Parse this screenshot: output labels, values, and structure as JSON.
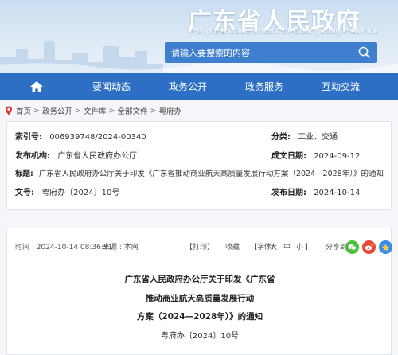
{
  "banner": {
    "title": "广东省人民政府",
    "subtitle": "People's Government of Guangdong Province",
    "search_placeholder": "请输入要搜索的内容"
  },
  "nav": {
    "items": [
      "要闻动态",
      "政务公开",
      "政务服务",
      "互动交流"
    ],
    "bg_color": "#2e6fc6"
  },
  "breadcrumb": {
    "items": [
      "首页",
      "政务公开",
      "文件库",
      "全部文件",
      "粤府办"
    ],
    "separator": ">"
  },
  "meta": {
    "index_label": "索引号:",
    "index_value": "006939748/2024-00340",
    "category_label": "分类:",
    "category_value": "工业、交通",
    "issuer_label": "发布机构:",
    "issuer_value": "广东省人民政府办公厅",
    "created_label": "成文日期:",
    "created_value": "2024-09-12",
    "title_label": "标题:",
    "title_value": "广东省人民政府办公厅关于印发《广东省推动商业航天高质量发展行动方案（2024—2028年）》的通知",
    "docno_label": "文号:",
    "docno_value": "粤府办〔2024〕10号",
    "published_label": "发布日期:",
    "published_value": "2024-10-14"
  },
  "toolbar": {
    "time": "时间 : 2024-10-14 08:36:51",
    "source": "来源 : 本网",
    "print": "【打印】",
    "favorite": "收藏",
    "font_prefix": "【字体:",
    "font_large": "大",
    "font_medium": "中",
    "font_small": "小",
    "font_suffix": "】",
    "share": "分享到:"
  },
  "article": {
    "title_line1": "广东省人民政府办公厅关于印发《广东省",
    "title_line2": "推动商业航天高质量发展行动",
    "title_line3": "方案（2024—2028年）》的通知",
    "doc_number": "粤府办〔2024〕10号"
  }
}
